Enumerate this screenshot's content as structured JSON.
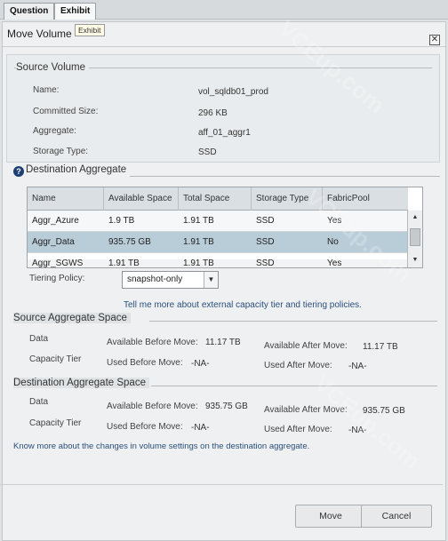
{
  "tabs": [
    {
      "label": "Question"
    },
    {
      "label": "Exhibit"
    }
  ],
  "tooltip": "Exhibit",
  "dialog": {
    "title": "Move Volume",
    "close": "✕"
  },
  "source_volume": {
    "title": "Source Volume",
    "fields": [
      {
        "label": "Name:",
        "value": "vol_sqldb01_prod"
      },
      {
        "label": "Committed Size:",
        "value": "296 KB"
      },
      {
        "label": "Aggregate:",
        "value": "aff_01_aggr1"
      },
      {
        "label": "Storage Type:",
        "value": "SSD"
      }
    ]
  },
  "destination_aggregate": {
    "title": "Destination Aggregate",
    "info_icon": "?",
    "columns": [
      "Name",
      "Available Space",
      "Total Space",
      "Storage Type",
      "FabricPool"
    ],
    "rows": [
      {
        "name": "Aggr_Azure",
        "available": "1.9 TB",
        "total": "1.91 TB",
        "storage": "SSD",
        "fabricpool": "Yes"
      },
      {
        "name": "Aggr_Data",
        "available": "935.75 GB",
        "total": "1.91 TB",
        "storage": "SSD",
        "fabricpool": "No"
      },
      {
        "name": "Aggr_SGWS",
        "available": "1.91 TB",
        "total": "1.91 TB",
        "storage": "SSD",
        "fabricpool": "Yes"
      }
    ],
    "selected_row": 1
  },
  "tiering": {
    "label": "Tiering Policy:",
    "value": "snapshot-only",
    "link": "Tell me more about external capacity tier and tiering policies."
  },
  "source_aggregate_space": {
    "title": "Source Aggregate Space",
    "data_label": "Data",
    "capacity_label": "Capacity Tier",
    "avail_before_label": "Available Before Move:",
    "avail_before": "11.17 TB",
    "avail_after_label": "Available After Move:",
    "avail_after": "11.17 TB",
    "used_before_label": "Used Before Move:",
    "used_before": "-NA-",
    "used_after_label": "Used After Move:",
    "used_after": "-NA-"
  },
  "destination_aggregate_space": {
    "title": "Destination Aggregate Space",
    "data_label": "Data",
    "capacity_label": "Capacity Tier",
    "avail_before_label": "Available Before Move:",
    "avail_before": "935.75 GB",
    "avail_after_label": "Available After Move:",
    "avail_after": "935.75 GB",
    "used_before_label": "Used Before Move:",
    "used_before": "-NA-",
    "used_after_label": "Used After Move:",
    "used_after": "-NA-"
  },
  "changes_link": "Know more about the changes in volume settings on the destination aggregate.",
  "buttons": {
    "move": "Move",
    "cancel": "Cancel"
  },
  "watermark": "VCEup.com"
}
